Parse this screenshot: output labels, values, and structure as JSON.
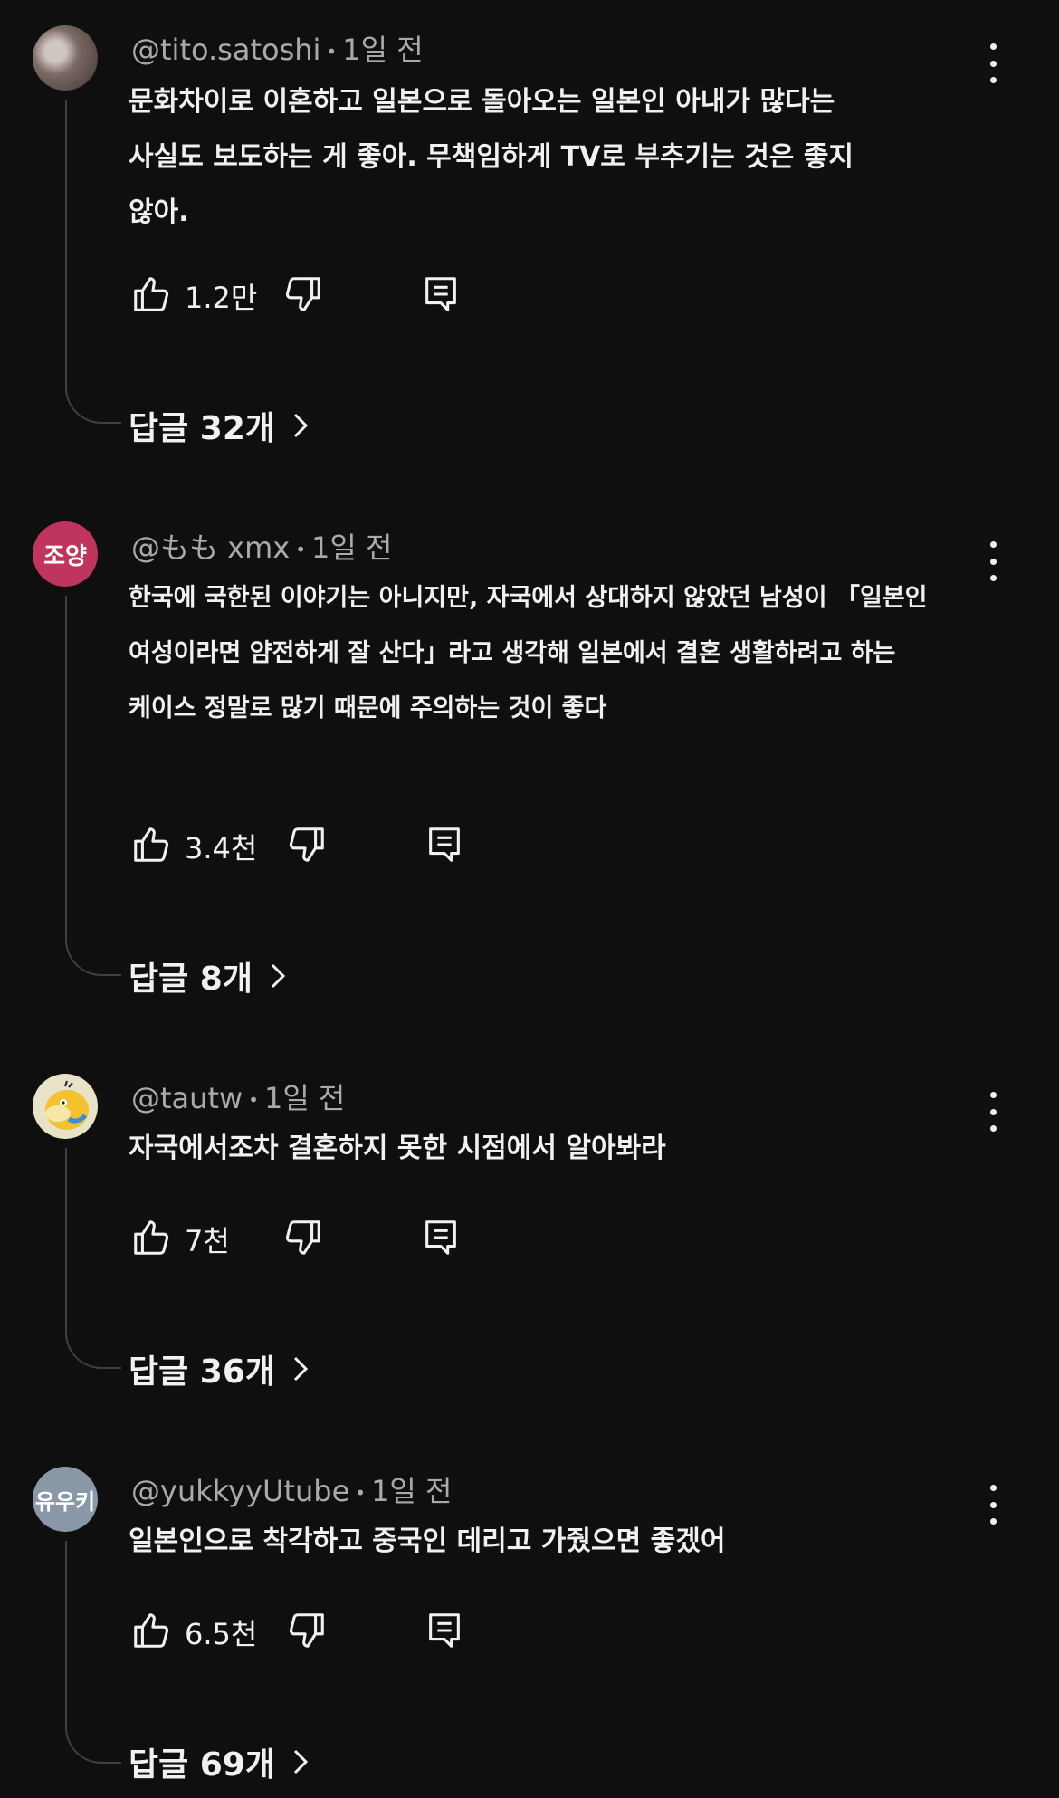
{
  "comments": [
    {
      "avatar_text": "",
      "avatar_color": "#6b5a55",
      "username": "@tito.satoshi",
      "time": "1일 전",
      "lines": [
        "문화차이로 이혼하고 일본으로 돌아오는 일본인 아내가 많다는",
        "사실도 보도하는 게 좋아. 무책임하게 TV로 부추기는 것은 좋지",
        "않아."
      ],
      "likes": "1.2만",
      "replies_label": "답글 32개"
    },
    {
      "avatar_text": "조양",
      "avatar_color": "#c0355e",
      "username": "@もも xmx",
      "time": "1일 전",
      "lines": [
        "한국에 국한된 이야기는 아니지만, 자국에서 상대하지 않았던 남성이 「일본인",
        "여성이라면 얌전하게 잘 산다」라고 생각해 일본에서 결혼 생활하려고 하는",
        "케이스 정말로 많기 때문에 주의하는 것이 좋다"
      ],
      "likes": "3.4천",
      "replies_label": "답글 8개"
    },
    {
      "avatar_text": "",
      "avatar_color": "#e7e2c8",
      "username": "@tautw",
      "time": "1일 전",
      "lines": [
        "자국에서조차 결혼하지 못한 시점에서 알아봐라"
      ],
      "likes": "7천",
      "replies_label": "답글 36개"
    },
    {
      "avatar_text": "유우키",
      "avatar_color": "#8a97a6",
      "username": "@yukkyyUtube",
      "time": "1일 전",
      "lines": [
        "일본인으로 착각하고 중국인 데리고 가줬으면 좋겠어"
      ],
      "likes": "6.5천",
      "replies_label": "답글 69개"
    }
  ],
  "icons": {
    "more": "more-vertical-icon",
    "like": "thumbs-up-icon",
    "dislike": "thumbs-down-icon",
    "reply": "reply-comment-icon",
    "chevron": "chevron-right-icon"
  }
}
